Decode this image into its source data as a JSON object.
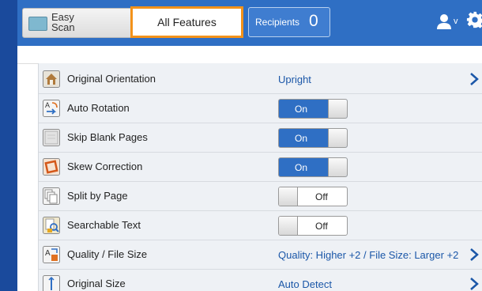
{
  "topbar": {
    "easy_scan": "Easy Scan",
    "all_features": "All Features",
    "recipients_label": "Recipients",
    "recipients_count": "0",
    "user_caret": "v"
  },
  "features": [
    {
      "label": "Original Orientation",
      "value": "Upright",
      "icon": "orientation-icon",
      "type": "link"
    },
    {
      "label": "Auto Rotation",
      "value": "On",
      "icon": "rotation-icon",
      "type": "toggle"
    },
    {
      "label": "Skip Blank Pages",
      "value": "On",
      "icon": "blank-page-icon",
      "type": "toggle"
    },
    {
      "label": "Skew Correction",
      "value": "On",
      "icon": "skew-icon",
      "type": "toggle"
    },
    {
      "label": "Split by Page",
      "value": "Off",
      "icon": "split-page-icon",
      "type": "toggle"
    },
    {
      "label": "Searchable Text",
      "value": "Off",
      "icon": "searchable-text-icon",
      "type": "toggle"
    },
    {
      "label": "Quality / File Size",
      "value": "Quality: Higher +2 / File Size: Larger +2",
      "icon": "quality-icon",
      "type": "link"
    },
    {
      "label": "Original Size",
      "value": "Auto Detect",
      "icon": "original-size-icon",
      "type": "link"
    }
  ],
  "colors": {
    "accent": "#2f6fc4",
    "tab_highlight": "#f3921a",
    "value_text": "#1b57a8"
  }
}
